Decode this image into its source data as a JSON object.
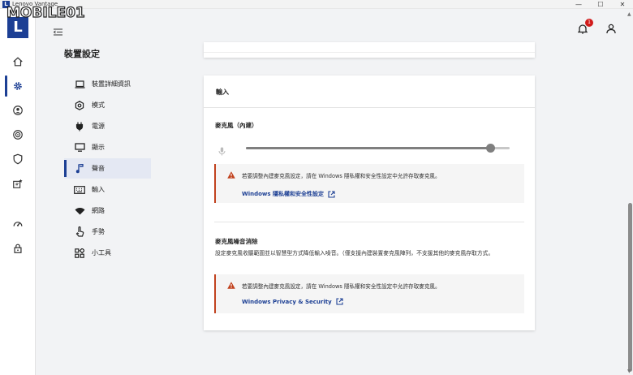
{
  "window": {
    "logo_letter": "L",
    "title": "Lenovo Vantage",
    "min": "—",
    "max": "☐",
    "close": "✕",
    "watermark": "MOBILE01"
  },
  "rail": {
    "logo_letter": "L"
  },
  "topbar": {
    "notification_count": "1"
  },
  "nav": {
    "page_title": "裝置設定",
    "items": [
      {
        "label": "裝置詳細資訊",
        "icon": "laptop-icon"
      },
      {
        "label": "模式",
        "icon": "hexagon-icon"
      },
      {
        "label": "電源",
        "icon": "plug-icon"
      },
      {
        "label": "顯示",
        "icon": "monitor-icon"
      },
      {
        "label": "聲音",
        "icon": "music-note-icon",
        "active": true
      },
      {
        "label": "輸入",
        "icon": "keyboard-icon"
      },
      {
        "label": "網路",
        "icon": "wifi-icon"
      },
      {
        "label": "手勢",
        "icon": "hand-icon"
      },
      {
        "label": "小工具",
        "icon": "widgets-icon"
      }
    ]
  },
  "input_card": {
    "title": "輸入",
    "mic_label": "麥克風（內建）",
    "mic_volume": 0.93,
    "warning_1": {
      "text": "若要調整內建麥克風設定，請在 Windows 隱私權和安全性設定中允許存取麥克風。",
      "link": "Windows 隱私權和安全性設定"
    },
    "noise_title": "麥克風噪音消除",
    "noise_desc": "設定麥克風收聽範圍並以智慧型方式降低輸入噪音。（僅支援內建裝置麥克風陣列，不支援其他的麥克風存取方式。",
    "warning_2": {
      "text": "若要調整內建麥克風設定，請在 Windows 隱私權和安全性設定中允許存取麥克風。",
      "link": "Windows Privacy & Security"
    }
  },
  "colors": {
    "brand": "#1c3f94",
    "warning": "#c1421e",
    "badge": "#d11b1b"
  }
}
